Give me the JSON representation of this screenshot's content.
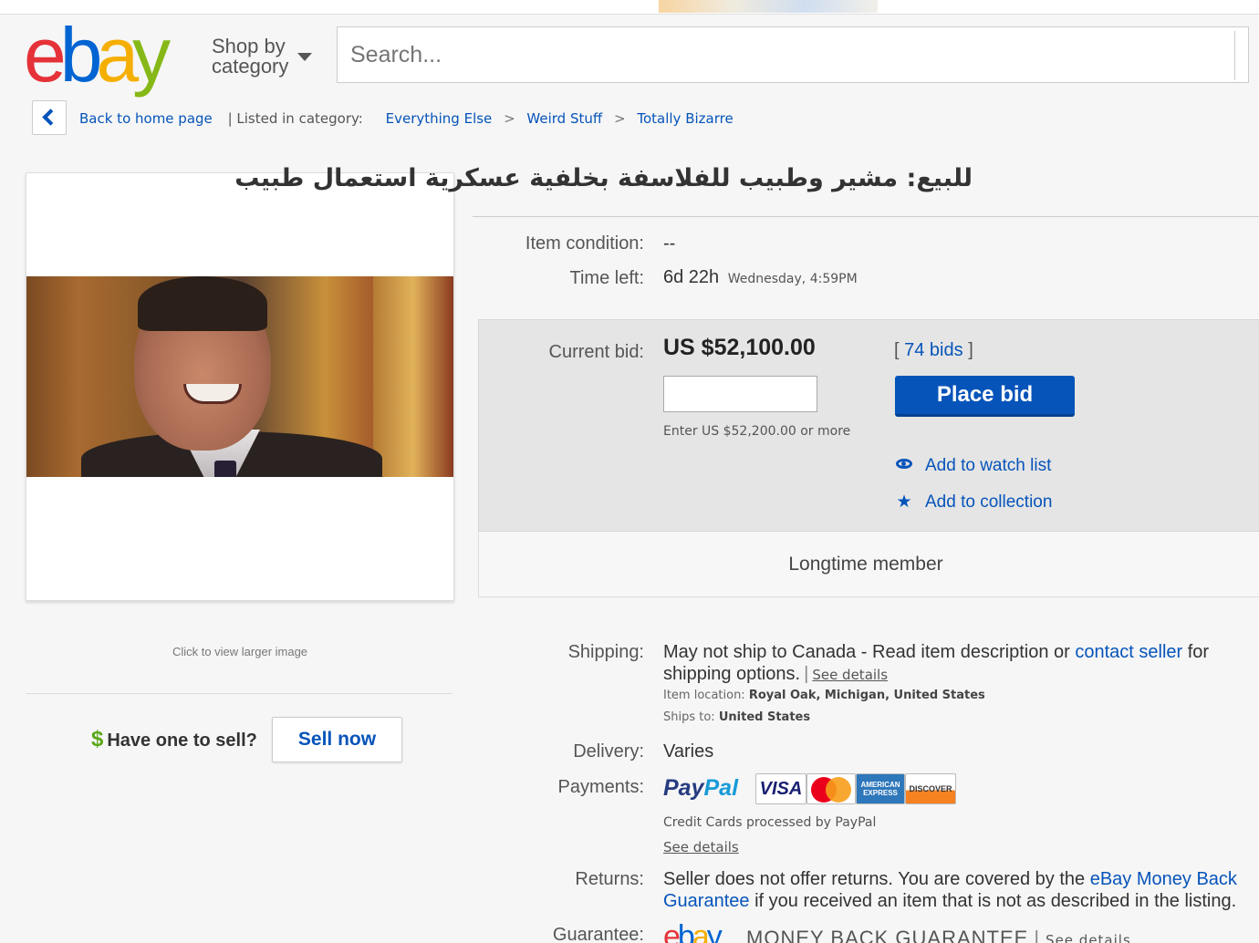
{
  "header": {
    "logo_letters": [
      "e",
      "b",
      "a",
      "y"
    ],
    "shop_by_line1": "Shop by",
    "shop_by_line2": "category",
    "search_placeholder": "Search..."
  },
  "breadcrumb": {
    "back_label": "Back to home page",
    "listed_label": "| Listed in category:",
    "categories": [
      "Everything Else",
      "Weird Stuff",
      "Totally Bizarre"
    ],
    "separator": ">"
  },
  "image_panel": {
    "click_larger": "Click to view larger image"
  },
  "sell": {
    "question": "Have one to sell?",
    "dollar": "$",
    "button": "Sell now"
  },
  "item": {
    "title": "للبيع: مشير وطبيب للفلاسفة بخلفية عسكرية استعمال طبيب",
    "condition_label": "Item condition:",
    "condition_value": "--",
    "time_left_label": "Time left:",
    "time_left_value": "6d 22h",
    "time_left_end": "Wednesday, 4:59PM"
  },
  "bid": {
    "current_label": "Current bid:",
    "price": "US $52,100.00",
    "bids_open": "[",
    "bids_count": "74 bids",
    "bids_close": "]",
    "input_value": "",
    "place_bid": "Place bid",
    "hint": "Enter US $52,200.00 or more",
    "watch": "Add to watch list",
    "collection": "Add to collection",
    "member": "Longtime member"
  },
  "shipping": {
    "label": "Shipping:",
    "text_before": "May not ship to Canada - Read item description or",
    "contact_link": "contact seller",
    "text_after": "for shipping options.",
    "see_details": "See details",
    "location_label": "Item location:",
    "location_value": "Royal Oak, Michigan, United States",
    "ships_to_label": "Ships to:",
    "ships_to_value": "United States"
  },
  "delivery": {
    "label": "Delivery:",
    "value": "Varies"
  },
  "payments": {
    "label": "Payments:",
    "paypal_part1": "Pay",
    "paypal_part2": "Pal",
    "cards": [
      "VISA",
      "MasterCard",
      "AMERICAN EXPRESS",
      "DISCOVER"
    ],
    "credit_note": "Credit Cards processed by PayPal",
    "see_details": "See details"
  },
  "returns": {
    "label": "Returns:",
    "text_before": "Seller does not offer returns. You are covered by the",
    "link": "eBay Money Back Guarantee",
    "text_after": "if you received an item that is not as described in the listing."
  },
  "guarantee": {
    "label": "Guarantee:",
    "logo_letters": [
      "e",
      "b",
      "a",
      "y"
    ],
    "text": "MONEY BACK GUARANTEE",
    "see_details": "See details"
  },
  "colors": {
    "ebay_red": "#e53238",
    "ebay_blue": "#0064d2",
    "ebay_yellow": "#f5af02",
    "ebay_green": "#86b817",
    "link_blue": "#0654ba",
    "bid_button": "#0654ba"
  }
}
